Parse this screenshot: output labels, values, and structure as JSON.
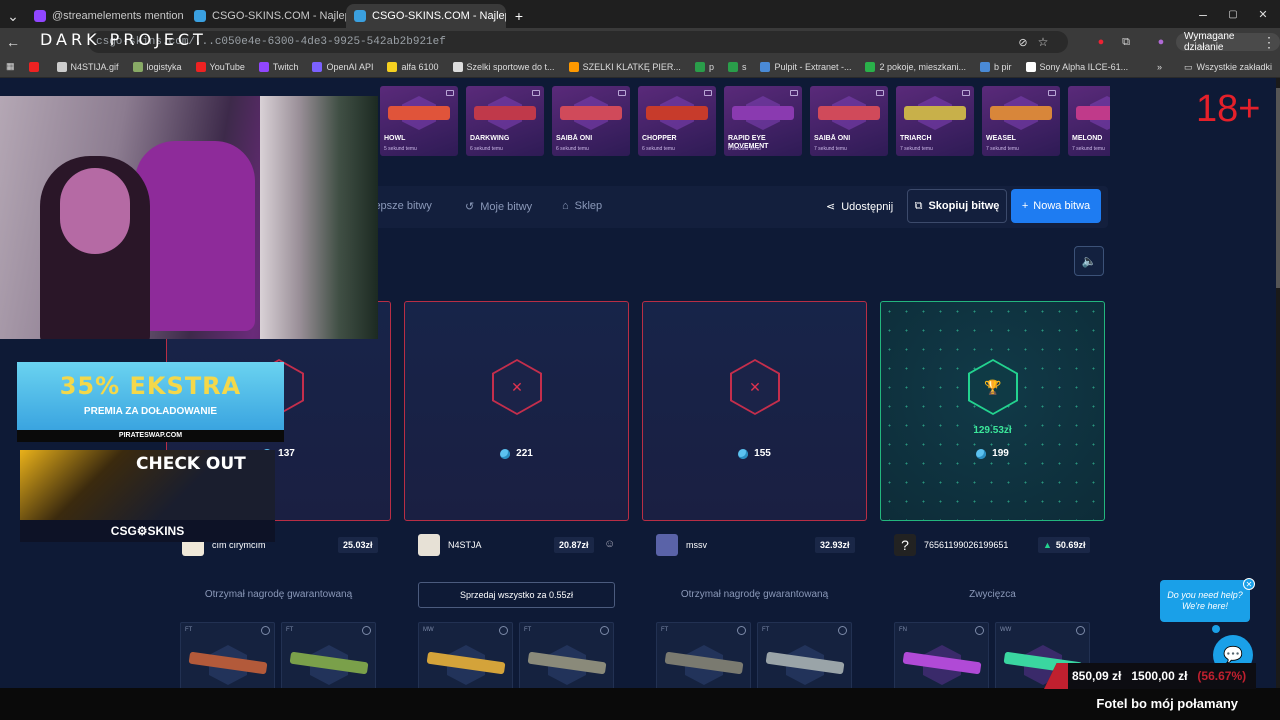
{
  "browser": {
    "tabs": [
      {
        "label": "@streamelements mention",
        "icon_color": "#9146ff"
      },
      {
        "label": "CSGO-SKINS.COM - Najlepsze",
        "icon_color": "#3aa0e0"
      },
      {
        "label": "CSGO-SKINS.COM - Najlep",
        "icon_color": "#3aa0e0"
      }
    ],
    "url": "csgo-skins.com/...c050e4e-6300-4de3-9925-542ab2b921ef",
    "required_action": "Wymagane działanie",
    "bookmarks": [
      "N4STIJA.gif",
      "logistyka",
      "YouTube",
      "Twitch",
      "OpenAI API",
      "alfa 6100",
      "Szelki sportowe do t...",
      "SZELKI KLATKĘ PIER...",
      "p",
      "s",
      "Pulpit - Extranet -...",
      "2 pokoje, mieszkani...",
      "b pir",
      "Sony Alpha ILCE-61..."
    ],
    "all_bookmarks": "Wszystkie zakładki"
  },
  "overlay": {
    "brand": "DARK PROJECT",
    "ad1_big": "35% EKSTRA",
    "ad1_mid": "PREMIA ZA DOŁADOWANIE",
    "ad1_site": "PIRATESWAP.COM",
    "ad2_check": "CHECK OUT",
    "ad2_logo": "CSG⚙SKINS",
    "price_now": "850,09 zł",
    "price_target": "1500,00 zł",
    "price_pct": "(56.67%)",
    "footer_text": "Fotel bo mój połamany"
  },
  "age_badge": "18+",
  "feed": [
    {
      "name": "HOWL",
      "sub": "5 sekund temu",
      "color": "#e0543a"
    },
    {
      "name": "DARKWING",
      "sub": "6 sekund temu",
      "color": "#c0394a"
    },
    {
      "name": "SAIBĀ ONI",
      "sub": "6 sekund temu",
      "color": "#d04a5a"
    },
    {
      "name": "CHOPPER",
      "sub": "6 sekund temu",
      "color": "#c73b2b"
    },
    {
      "name": "RAPID EYE MOVEMENT",
      "sub": "6 sekund temu",
      "color": "#8a3ab0"
    },
    {
      "name": "SAIBĀ ONI",
      "sub": "7 sekund temu",
      "color": "#d04a5a"
    },
    {
      "name": "TRIARCH",
      "sub": "7 sekund temu",
      "color": "#c8b04a"
    },
    {
      "name": "WEASEL",
      "sub": "7 sekund temu",
      "color": "#d8863a"
    },
    {
      "name": "MELOND",
      "sub": "7 sekund temu",
      "color": "#c03a8a"
    }
  ],
  "nav": {
    "best": "lepsze bitwy",
    "mine": "Moje bitwy",
    "shop": "Sklep",
    "share": "Udostępnij",
    "copy": "Skopiuj bitwę",
    "new": "Nowa bitwa"
  },
  "players": [
    {
      "coins": "137",
      "name": "cım cırymcım",
      "value": "25.03zł",
      "status": "Otrzymał nagrodę gwarantowaną",
      "items": [
        "FT",
        "FT"
      ]
    },
    {
      "coins": "221",
      "name": "N4STJA",
      "value": "20.87zł",
      "sell_all": "Sprzedaj wszystko za 0.55zł",
      "items": [
        "MW",
        "FT"
      ]
    },
    {
      "coins": "155",
      "name": "mssv",
      "value": "32.93zł",
      "status": "Otrzymał nagrodę gwarantowaną",
      "items": [
        "FT",
        "FT"
      ]
    },
    {
      "coins": "199",
      "name": "76561199026199651",
      "value": "50.69zł",
      "won": "129.53zł",
      "status": "Zwycięzca",
      "items": [
        "FN",
        "WW"
      ]
    }
  ],
  "help": {
    "line1": "Do you need help?",
    "line2": "We're here!"
  },
  "colors": {
    "accent": "#1e7cf2",
    "lose": "#c42e4c",
    "win": "#23d38f",
    "age": "#e5202a"
  }
}
